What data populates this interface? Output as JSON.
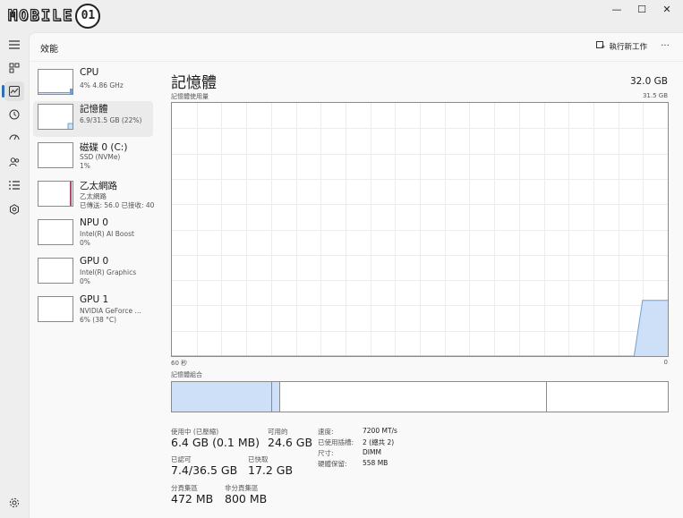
{
  "logo": {
    "text": "MOBILE",
    "badge": "01"
  },
  "window_controls": {
    "minimize": "—",
    "maximize": "☐",
    "close": "✕"
  },
  "header": {
    "title": "效能",
    "run_task": "執行新工作",
    "more": "···"
  },
  "devices": [
    {
      "name": "CPU",
      "sub1": "4% 4.86 GHz",
      "sub2": ""
    },
    {
      "name": "記憶體",
      "sub1": "6.9/31.5 GB (22%)",
      "sub2": ""
    },
    {
      "name": "磁碟 0 (C:)",
      "sub1": "SSD (NVMe)",
      "sub2": "1%"
    },
    {
      "name": "乙太網路",
      "sub1": "乙太網路",
      "sub2": "已傳送: 56.0 已接收: 40"
    },
    {
      "name": "NPU 0",
      "sub1": "Intel(R) AI Boost",
      "sub2": "0%"
    },
    {
      "name": "GPU 0",
      "sub1": "Intel(R) Graphics",
      "sub2": "0%"
    },
    {
      "name": "GPU 1",
      "sub1": "NVIDIA GeForce ...",
      "sub2": "6% (38 °C)"
    }
  ],
  "memory": {
    "title": "記憶體",
    "total": "32.0 GB",
    "usage_label": "記憶體使用量",
    "usage_max": "31.5 GB",
    "time_left": "60 秒",
    "time_right": "0",
    "composition_label": "記憶體組合",
    "stats": {
      "in_use_label": "使用中 (已壓縮)",
      "in_use_value": "6.4 GB (0.1 MB)",
      "available_label": "可用的",
      "available_value": "24.6 GB",
      "committed_label": "已認可",
      "committed_value": "7.4/36.5 GB",
      "cached_label": "已快取",
      "cached_value": "17.2 GB",
      "paged_label": "分頁集區",
      "paged_value": "472 MB",
      "nonpaged_label": "非分頁集區",
      "nonpaged_value": "800 MB"
    },
    "details": [
      {
        "label": "速度:",
        "value": "7200 MT/s"
      },
      {
        "label": "已使用插槽:",
        "value": "2 (總共 2)"
      },
      {
        "label": "尺寸:",
        "value": "DIMM"
      },
      {
        "label": "硬體保留:",
        "value": "558 MB"
      }
    ],
    "usage_history_percent": [
      0,
      0,
      0,
      0,
      0,
      0,
      0,
      0,
      0,
      0,
      0,
      0,
      0,
      0,
      0,
      0,
      0,
      0,
      0,
      0,
      0,
      0,
      0,
      0,
      0,
      0,
      0,
      0,
      0,
      0,
      0,
      0,
      0,
      0,
      0,
      0,
      0,
      0,
      0,
      0,
      0,
      0,
      0,
      0,
      0,
      0,
      0,
      0,
      0,
      0,
      0,
      0,
      0,
      0,
      0,
      0,
      22,
      22,
      22,
      22
    ],
    "composition_percent": {
      "in_use": 20.3,
      "modified": 1.6,
      "standby": 53.7,
      "free": 24.4
    }
  },
  "colors": {
    "memory_fill": "#cde0f8",
    "memory_stroke": "#6f9ed6",
    "ethernet_accent": "#b44a6a",
    "grid": "#ececec",
    "border": "#8a8a8a",
    "accent": "#2c6fb4"
  }
}
